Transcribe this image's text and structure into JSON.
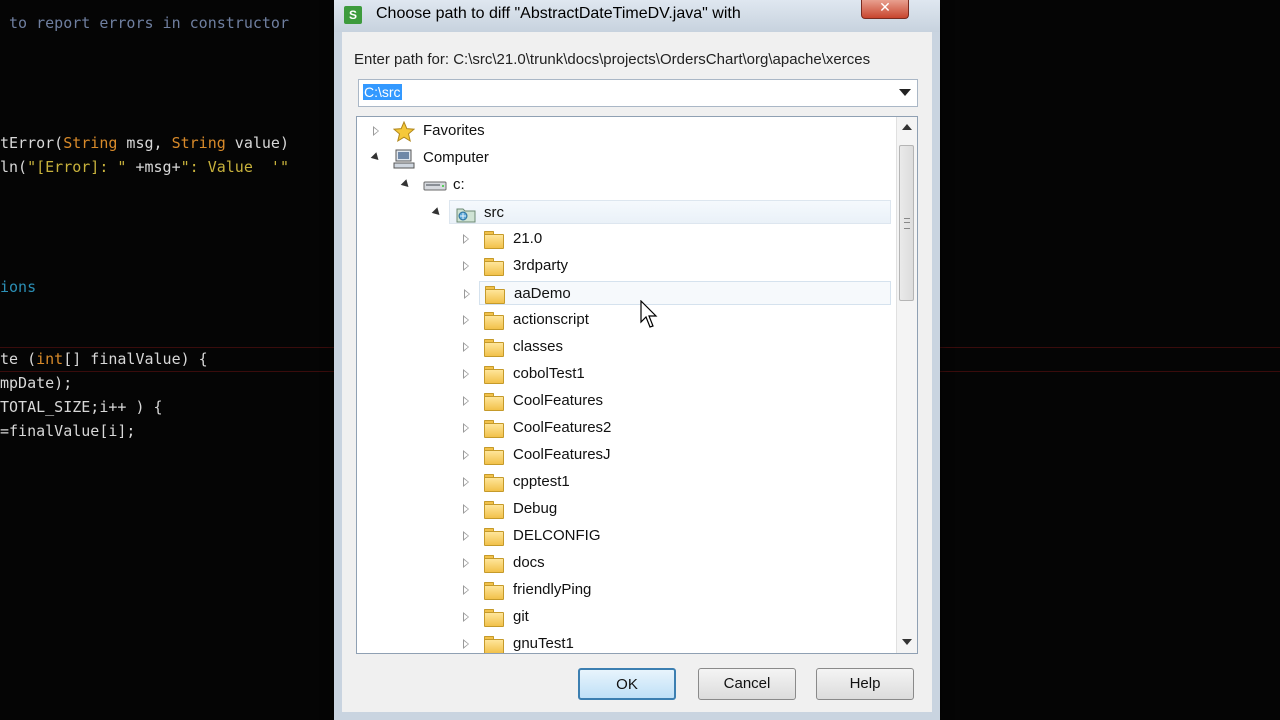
{
  "editor": {
    "lines": [
      {
        "segments": [
          {
            "text": " to report errors in constructor",
            "cls": "c-comment"
          }
        ]
      },
      {
        "segments": [
          {
            "text": "tError(",
            "cls": ""
          },
          {
            "text": "String",
            "cls": "c-type"
          },
          {
            "text": " msg, ",
            "cls": ""
          },
          {
            "text": "String",
            "cls": "c-type"
          },
          {
            "text": " value)",
            "cls": ""
          }
        ]
      },
      {
        "segments": [
          {
            "text": "ln(",
            "cls": ""
          },
          {
            "text": "\"[Error]: \"",
            "cls": "c-str"
          },
          {
            "text": " +msg+",
            "cls": ""
          },
          {
            "text": "\": Value  '\"",
            "cls": "c-str"
          }
        ]
      },
      {
        "segments": [
          {
            "text": "ions",
            "cls": "c-blue"
          }
        ]
      },
      {
        "segments": [
          {
            "text": "te (",
            "cls": ""
          },
          {
            "text": "int",
            "cls": "c-kw"
          },
          {
            "text": "[] finalValue) {",
            "cls": ""
          }
        ]
      },
      {
        "segments": [
          {
            "text": "mpDate);",
            "cls": ""
          }
        ]
      },
      {
        "segments": [
          {
            "text": "TOTAL_SIZE;i++ ) {",
            "cls": ""
          }
        ]
      },
      {
        "segments": [
          {
            "text": "=finalValue[i];",
            "cls": ""
          }
        ]
      }
    ]
  },
  "dialog": {
    "title": "Choose path to diff \"AbstractDateTimeDV.java\" with",
    "title_icon": "S",
    "close_glyph": "✕",
    "path_label": "Enter path for:  C:\\src\\21.0\\trunk\\docs\\projects\\OrdersChart\\org\\apache\\xerces",
    "path_value": "C:\\src",
    "tree": [
      {
        "label": "Favorites",
        "icon": "star-icon",
        "expander": "closed"
      },
      {
        "label": "Computer",
        "icon": "computer-icon",
        "expander": "open"
      },
      {
        "label": "c:",
        "icon": "drive-icon",
        "expander": "open"
      },
      {
        "label": "src",
        "icon": "shared-folder-icon",
        "expander": "open",
        "selected": true
      },
      {
        "label": "21.0",
        "icon": "folder-icon",
        "expander": "closed"
      },
      {
        "label": "3rdparty",
        "icon": "folder-icon",
        "expander": "closed"
      },
      {
        "label": "aaDemo",
        "icon": "folder-icon",
        "expander": "closed",
        "hover": true
      },
      {
        "label": "actionscript",
        "icon": "folder-icon",
        "expander": "closed"
      },
      {
        "label": "classes",
        "icon": "folder-icon",
        "expander": "closed"
      },
      {
        "label": "cobolTest1",
        "icon": "folder-icon",
        "expander": "closed"
      },
      {
        "label": "CoolFeatures",
        "icon": "folder-icon",
        "expander": "closed"
      },
      {
        "label": "CoolFeatures2",
        "icon": "folder-icon",
        "expander": "closed"
      },
      {
        "label": "CoolFeaturesJ",
        "icon": "folder-icon",
        "expander": "closed"
      },
      {
        "label": "cpptest1",
        "icon": "folder-icon",
        "expander": "closed"
      },
      {
        "label": "Debug",
        "icon": "folder-icon",
        "expander": "closed"
      },
      {
        "label": "DELCONFIG",
        "icon": "folder-icon",
        "expander": "closed"
      },
      {
        "label": "docs",
        "icon": "folder-icon",
        "expander": "closed"
      },
      {
        "label": "friendlyPing",
        "icon": "folder-icon",
        "expander": "closed"
      },
      {
        "label": "git",
        "icon": "folder-icon",
        "expander": "closed"
      },
      {
        "label": "gnuTest1",
        "icon": "folder-icon",
        "expander": "closed"
      }
    ],
    "buttons": {
      "ok": "OK",
      "cancel": "Cancel",
      "help": "Help"
    }
  }
}
